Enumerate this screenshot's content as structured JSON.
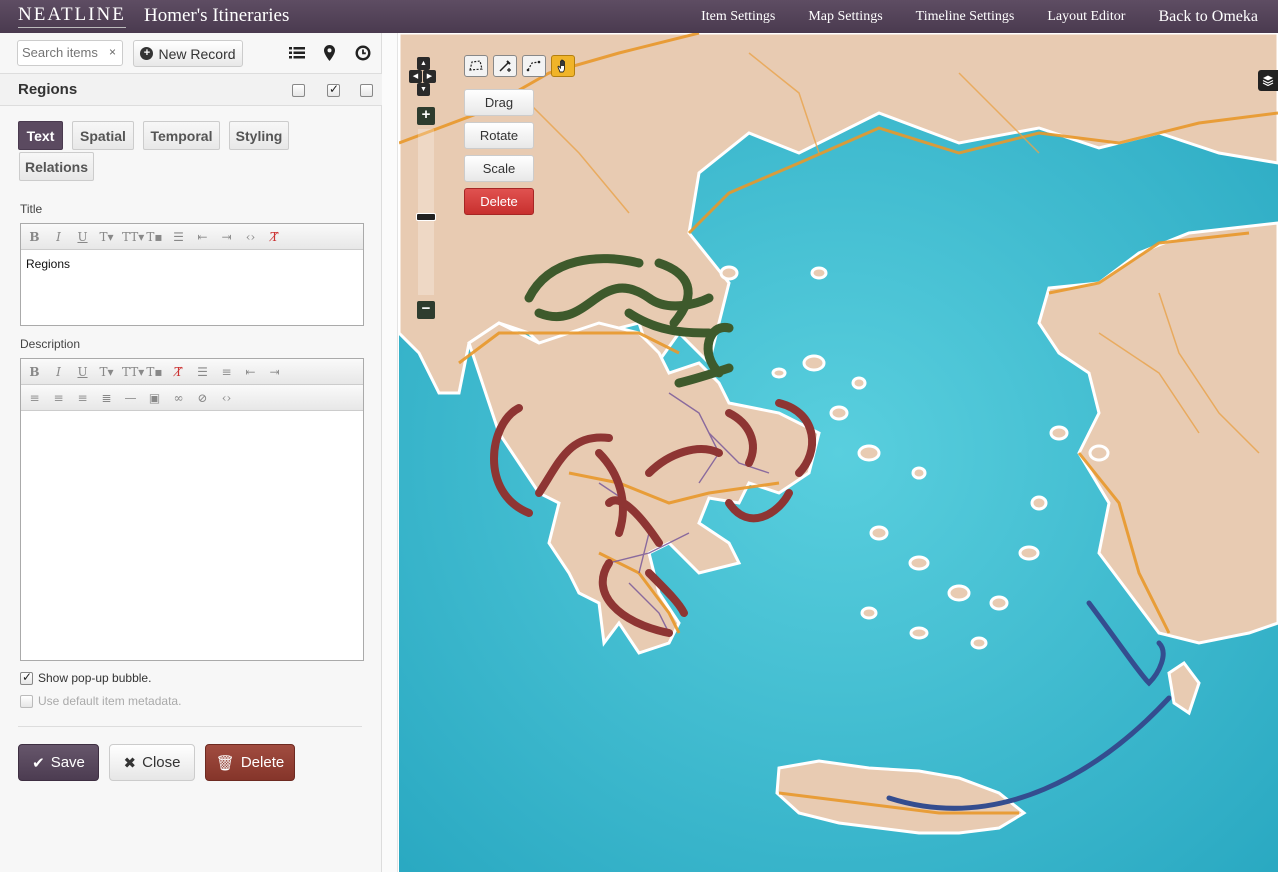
{
  "app": {
    "logo": "NEATLINE",
    "exhibit_title": "Homer's Itineraries",
    "nav": [
      "Item Settings",
      "Map Settings",
      "Timeline Settings",
      "Layout Editor"
    ],
    "back_link": "Back to Omeka"
  },
  "toolbar": {
    "search_placeholder": "Search items",
    "search_clear": "×",
    "new_record": "New Record"
  },
  "record": {
    "name": "Regions",
    "tabs": [
      "Text",
      "Spatial",
      "Temporal",
      "Styling",
      "Relations"
    ],
    "active_tab": "Text",
    "title_label": "Title",
    "title_value": "Regions",
    "description_label": "Description",
    "description_value": "",
    "show_popup_label": "Show pop-up bubble.",
    "show_popup_checked": true,
    "use_default_label": "Use default item metadata.",
    "use_default_checked": false
  },
  "actions": {
    "save": "Save",
    "close": "Close",
    "delete": "Delete"
  },
  "map_controls": {
    "drag": "Drag",
    "rotate": "Rotate",
    "scale": "Scale",
    "delete": "Delete",
    "zoom_in": "+",
    "zoom_out": "−"
  },
  "colors": {
    "header_bg": "#4f3f54",
    "accent_purple": "#5b4a60",
    "danger_red": "#c8302e",
    "brown_red": "#8e3c31",
    "sea": "#3bbccf",
    "land": "#e7c9ae",
    "road_orange": "#e89a2a",
    "arrow_green": "#3c5628",
    "arrow_red": "#8e3533",
    "arrow_blue": "#344d8f"
  }
}
